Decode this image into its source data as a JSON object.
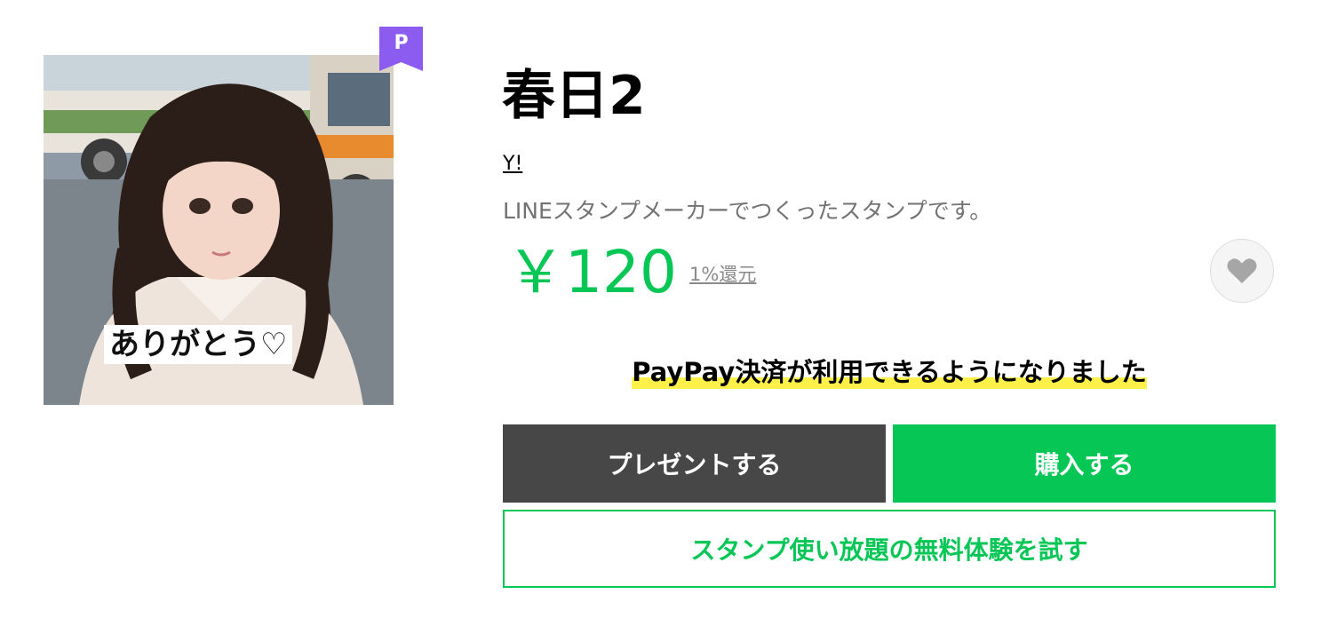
{
  "product": {
    "title": "春日2",
    "author": "Y!",
    "description": "LINEスタンプメーカーでつくったスタンプです。",
    "price": "￥120",
    "cashback": "1%還元",
    "premium_badge": "P",
    "sticker_caption": "ありがとう♡",
    "favorite_icon": "heart-icon"
  },
  "notice": {
    "text": "PayPay決済が利用できるようになりました"
  },
  "actions": {
    "gift_label": "プレゼントする",
    "buy_label": "購入する",
    "trial_label": "スタンプ使い放題の無料体験を試す"
  },
  "colors": {
    "accent_green": "#06c755",
    "gift_button": "#474747",
    "premium_purple": "#8c5cf0",
    "highlight_yellow": "#fff04a"
  }
}
